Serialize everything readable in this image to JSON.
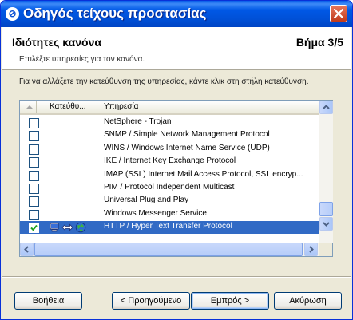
{
  "window": {
    "title": "Οδηγός τείχους προστασίας"
  },
  "header": {
    "title": "Ιδιότητες κανόνα",
    "step": "Βήμα 3/5",
    "subtitle": "Επιλέξτε υπηρεσίες για τον κανόνα."
  },
  "instruction": "Για να αλλάξετε την κατεύθυνση της υπηρεσίας, κάντε κλικ στη στήλη κατεύθυνση.",
  "list": {
    "columns": [
      "Κατεύθυ...",
      "Υπηρεσία"
    ],
    "rows": [
      {
        "checked": false,
        "selected": false,
        "name": "NetSphere - Trojan"
      },
      {
        "checked": false,
        "selected": false,
        "name": "SNMP / Simple Network Management Protocol"
      },
      {
        "checked": false,
        "selected": false,
        "name": "WINS / Windows Internet Name Service (UDP)"
      },
      {
        "checked": false,
        "selected": false,
        "name": "IKE / Internet Key Exchange Protocol"
      },
      {
        "checked": false,
        "selected": false,
        "name": "IMAP (SSL) Internet Mail Access Protocol, SSL encryp..."
      },
      {
        "checked": false,
        "selected": false,
        "name": "PIM / Protocol Independent Multicast"
      },
      {
        "checked": false,
        "selected": false,
        "name": "Universal Plug and Play"
      },
      {
        "checked": false,
        "selected": false,
        "name": "Windows Messenger Service"
      },
      {
        "checked": true,
        "selected": true,
        "name": "HTTP / Hyper Text Transfer Protocol",
        "direction_icons": [
          "computer-icon",
          "bidirectional-arrow-icon",
          "globe-icon"
        ]
      }
    ]
  },
  "buttons": {
    "help": "Βοήθεια",
    "back": "< Προηγούμενο",
    "next": "Εμπρός >",
    "cancel": "Ακύρωση"
  },
  "colors": {
    "titlebar": "#0054e3",
    "selection": "#316ac5",
    "face": "#ece9d8"
  }
}
